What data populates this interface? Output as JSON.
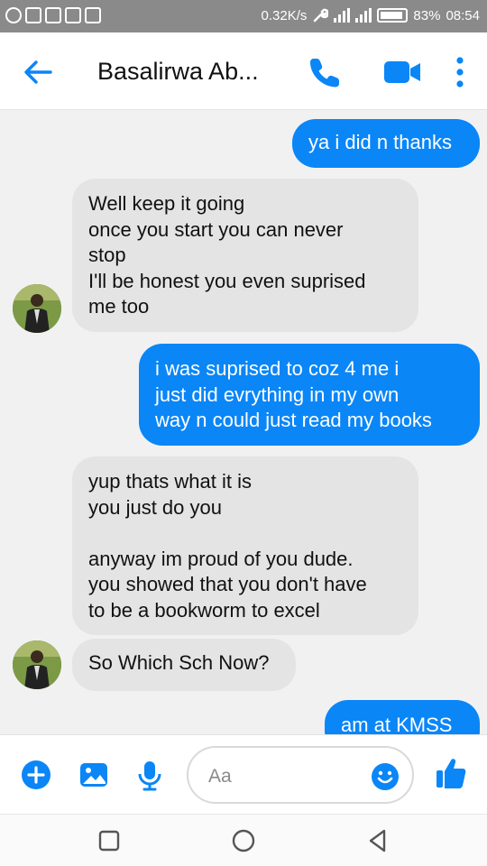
{
  "status_bar": {
    "speed": "0.32K/s",
    "battery": "83%",
    "time": "08:54"
  },
  "header": {
    "contact_name": "Basalirwa Ab..."
  },
  "messages": [
    {
      "sender": "me",
      "text": "ya i did n thanks"
    },
    {
      "sender": "contact",
      "text": "Well keep it going\nonce you start you can never\nstop\nI'll be honest you even suprised\nme too"
    },
    {
      "sender": "me",
      "text": "i was suprised to coz 4 me i\njust did evrything in my own\nway n could just read my books"
    },
    {
      "sender": "contact",
      "text": "yup thats what it is\nyou just do you\n\nanyway im proud of you dude.\nyou showed that you don't have\nto be a bookworm to excel"
    },
    {
      "sender": "contact",
      "text": "So Which Sch Now?"
    },
    {
      "sender": "me",
      "text": "am at KMSS"
    }
  ],
  "composer": {
    "placeholder": "Aa"
  },
  "colors": {
    "accent": "#0a86f7",
    "incoming_bubble": "#e4e4e4",
    "chat_background": "#f1f1f1"
  },
  "icons": {
    "back": "arrow-left-icon",
    "call": "phone-icon",
    "video": "video-camera-icon",
    "more": "vertical-dots-icon",
    "add": "plus-circle-icon",
    "photo": "image-icon",
    "voice": "microphone-icon",
    "emoji": "smiley-icon",
    "like": "thumbs-up-icon"
  }
}
